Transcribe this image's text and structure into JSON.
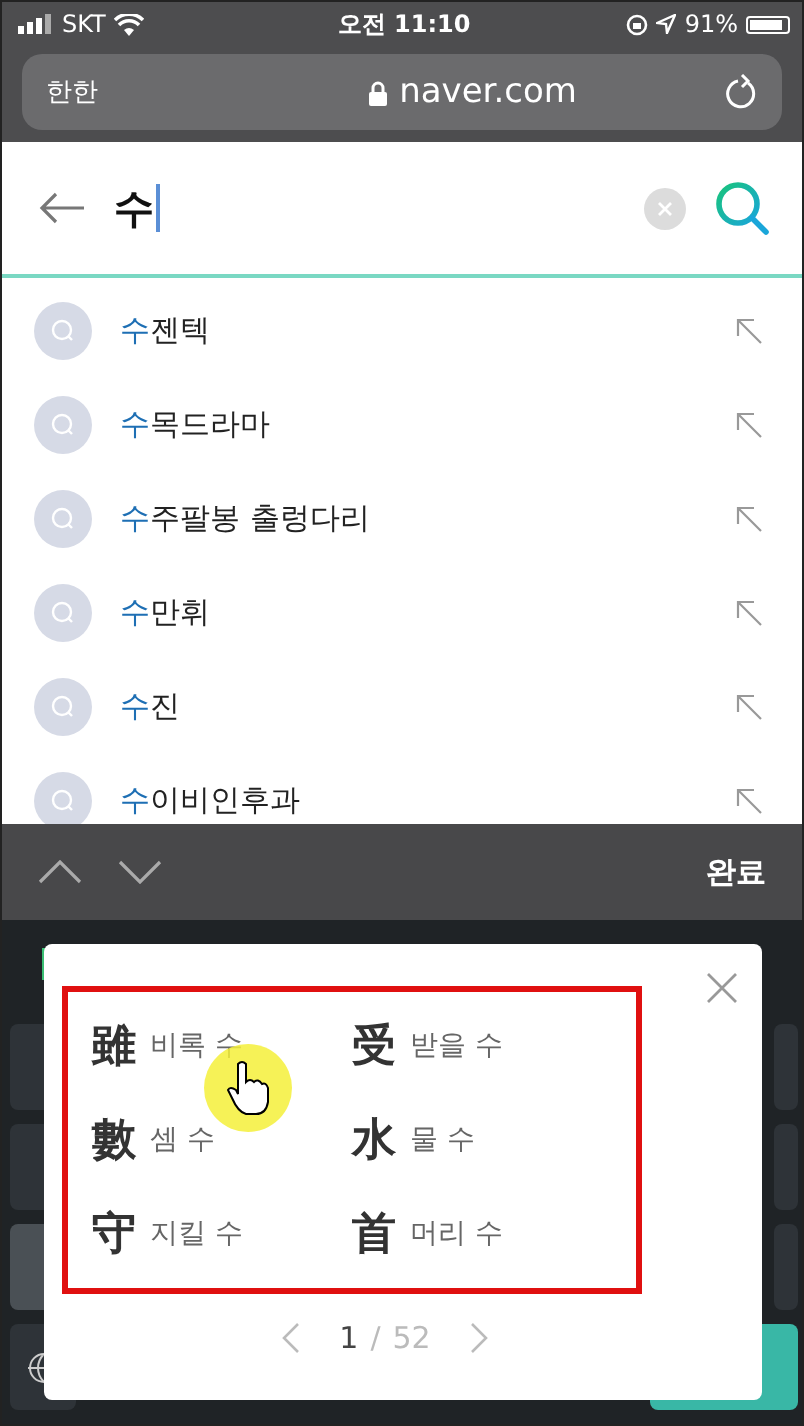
{
  "status_bar": {
    "carrier": "SKT",
    "time": "오전 11:10",
    "battery": "91%"
  },
  "address_bar": {
    "text_size": "한한",
    "url": "naver.com"
  },
  "search": {
    "value": "수"
  },
  "suggestions": [
    {
      "match": "수",
      "rest": "젠텍"
    },
    {
      "match": "수",
      "rest": "목드라마"
    },
    {
      "match": "수",
      "rest": "주팔봉 출렁다리"
    },
    {
      "match": "수",
      "rest": "만휘"
    },
    {
      "match": "수",
      "rest": "진"
    },
    {
      "match": "수",
      "rest": "이비인후과"
    }
  ],
  "keyboard_toolbar": {
    "done": "완료"
  },
  "hanja_popup": {
    "items": [
      {
        "hanja": "雖",
        "reading": "비록 수"
      },
      {
        "hanja": "受",
        "reading": "받을 수"
      },
      {
        "hanja": "數",
        "reading": "셈 수"
      },
      {
        "hanja": "水",
        "reading": "물 수"
      },
      {
        "hanja": "守",
        "reading": "지킬 수"
      },
      {
        "hanja": "首",
        "reading": "머리 수"
      }
    ],
    "page": "1",
    "separator": "/",
    "total": "52"
  }
}
